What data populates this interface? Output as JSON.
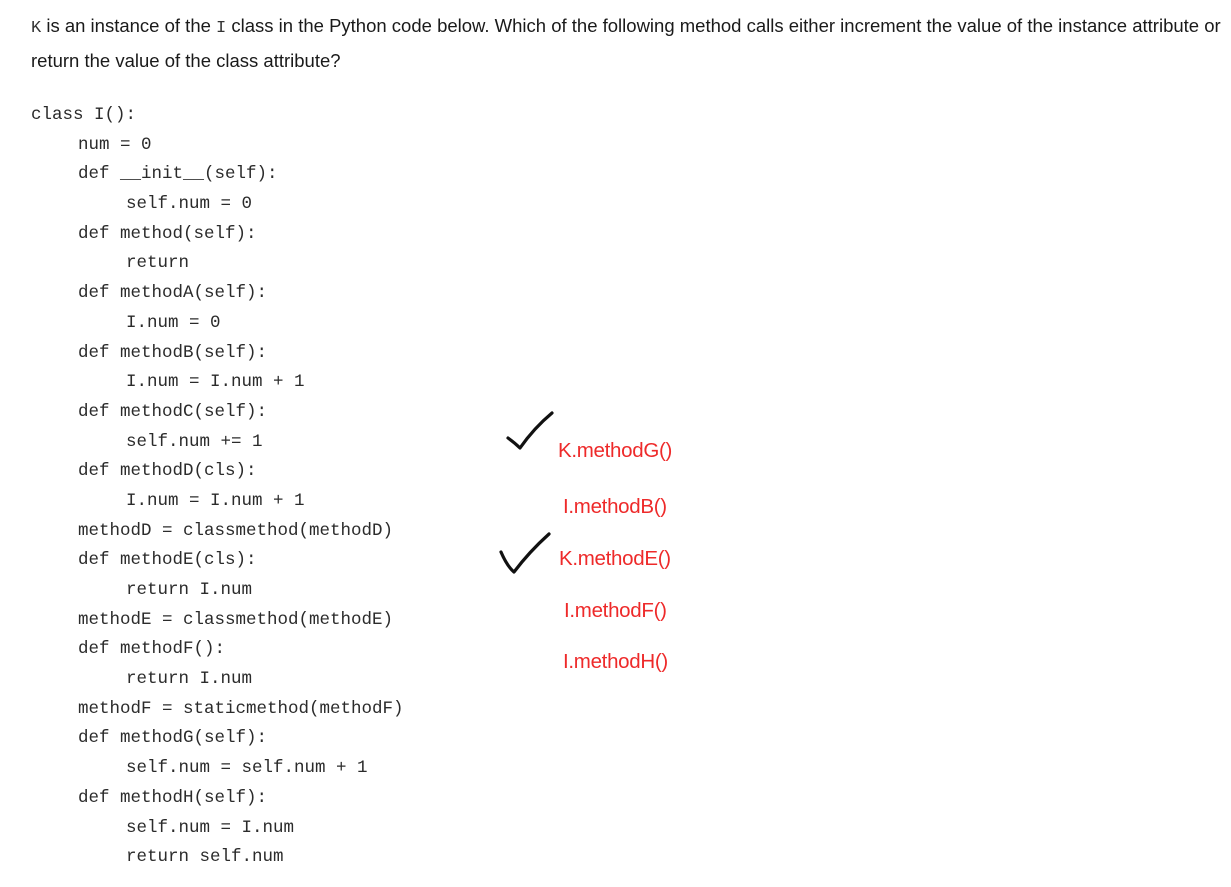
{
  "question": {
    "instance_name": "K",
    "text_1": " is an instance of the ",
    "class_name": "I",
    "text_2": " class in the Python code below. Which of the following method calls either increment the value of the instance attribute or return the value of the class attribute?"
  },
  "code": {
    "lines": [
      {
        "indent": 0,
        "text": "class I():"
      },
      {
        "indent": 1,
        "text": "num = 0"
      },
      {
        "indent": 1,
        "text": "def __init__(self):"
      },
      {
        "indent": 2,
        "text": "self.num = 0"
      },
      {
        "indent": 1,
        "text": "def method(self):"
      },
      {
        "indent": 2,
        "text": "return"
      },
      {
        "indent": 1,
        "text": "def methodA(self):"
      },
      {
        "indent": 2,
        "text": "I.num = 0"
      },
      {
        "indent": 1,
        "text": "def methodB(self):"
      },
      {
        "indent": 2,
        "text": "I.num = I.num + 1"
      },
      {
        "indent": 1,
        "text": "def methodC(self):"
      },
      {
        "indent": 2,
        "text": "self.num += 1"
      },
      {
        "indent": 1,
        "text": "def methodD(cls):"
      },
      {
        "indent": 2,
        "text": "I.num = I.num + 1"
      },
      {
        "indent": 1,
        "text": "methodD = classmethod(methodD)"
      },
      {
        "indent": 1,
        "text": "def methodE(cls):"
      },
      {
        "indent": 2,
        "text": "return I.num"
      },
      {
        "indent": 1,
        "text": "methodE = classmethod(methodE)"
      },
      {
        "indent": 1,
        "text": "def methodF():"
      },
      {
        "indent": 2,
        "text": "return I.num"
      },
      {
        "indent": 1,
        "text": "methodF = staticmethod(methodF)"
      },
      {
        "indent": 1,
        "text": "def methodG(self):"
      },
      {
        "indent": 2,
        "text": "self.num = self.num + 1"
      },
      {
        "indent": 1,
        "text": "def methodH(self):"
      },
      {
        "indent": 2,
        "text": "self.num = I.num"
      },
      {
        "indent": 2,
        "text": "return self.num"
      }
    ]
  },
  "options": [
    {
      "label": "K.methodG()",
      "checked": true
    },
    {
      "label": "I.methodB()",
      "checked": false
    },
    {
      "label": "K.methodE()",
      "checked": true
    },
    {
      "label": "I.methodF()",
      "checked": false
    },
    {
      "label": "I.methodH()",
      "checked": false
    }
  ],
  "colors": {
    "option_text": "#ee2a2a",
    "checkmark": "#111111"
  },
  "icons": {
    "checkmark": "checkmark-icon"
  }
}
